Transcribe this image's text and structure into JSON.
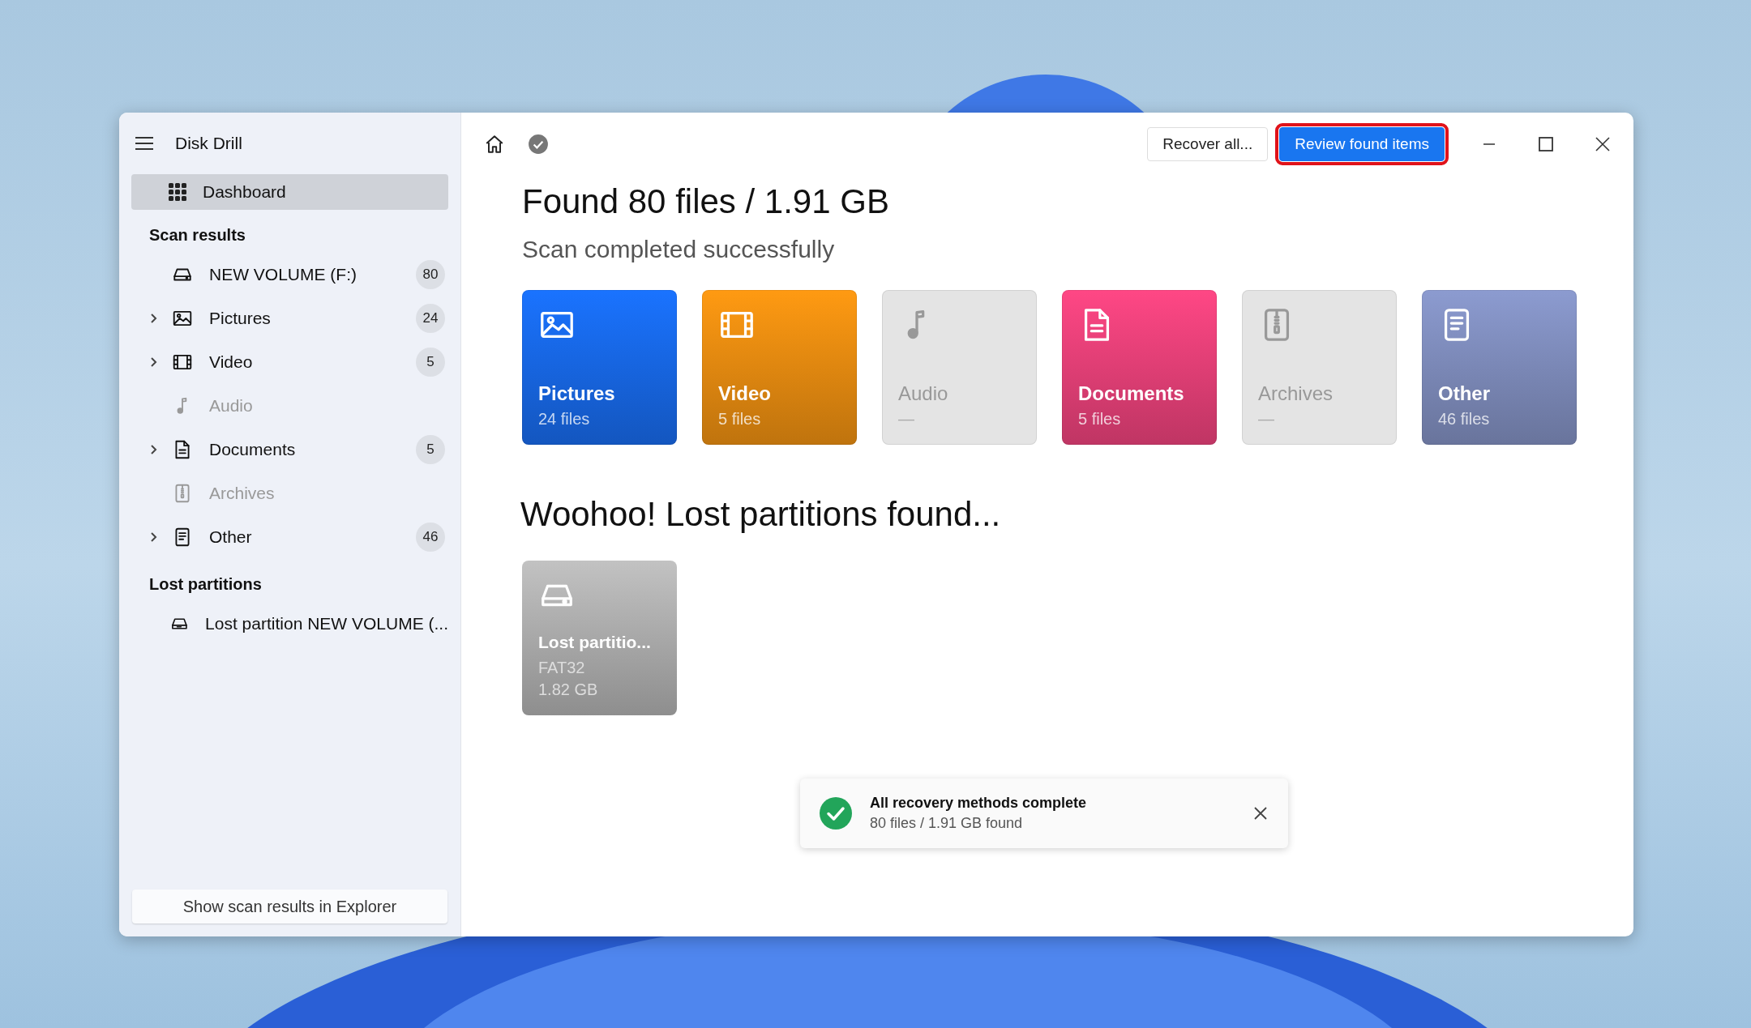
{
  "window": {
    "title": "Disk Drill"
  },
  "sidebar": {
    "dashboard": {
      "label": "Dashboard",
      "selected": true
    },
    "scan_results": {
      "heading": "Scan results",
      "items": [
        {
          "kind": "drive",
          "label": "NEW VOLUME (F:)",
          "count": "80",
          "expandable": false,
          "disabled": false
        },
        {
          "kind": "pictures",
          "label": "Pictures",
          "count": "24",
          "expandable": true,
          "disabled": false
        },
        {
          "kind": "video",
          "label": "Video",
          "count": "5",
          "expandable": true,
          "disabled": false
        },
        {
          "kind": "audio",
          "label": "Audio",
          "expandable": false,
          "disabled": true
        },
        {
          "kind": "documents",
          "label": "Documents",
          "count": "5",
          "expandable": true,
          "disabled": false
        },
        {
          "kind": "archives",
          "label": "Archives",
          "expandable": false,
          "disabled": true
        },
        {
          "kind": "other",
          "label": "Other",
          "count": "46",
          "expandable": true,
          "disabled": false
        }
      ]
    },
    "lost_partitions": {
      "heading": "Lost partitions",
      "items": [
        {
          "kind": "partition",
          "label": "Lost partition NEW VOLUME (...",
          "expandable": false,
          "disabled": false
        }
      ]
    },
    "footer_button": "Show scan results in Explorer"
  },
  "toolbar": {
    "recover_button": "Recover all...",
    "review_button": {
      "label": "Review found items",
      "highlighted": true
    }
  },
  "summary": {
    "title": "Found 80 files / 1.91 GB",
    "subtitle": "Scan completed successfully"
  },
  "categories": [
    {
      "kind": "pictures",
      "label": "Pictures",
      "detail": "24 files",
      "disabled": false,
      "color": "#1a73ff"
    },
    {
      "kind": "video",
      "label": "Video",
      "detail": "5 files",
      "disabled": false,
      "color": "#ff9a12"
    },
    {
      "kind": "audio",
      "label": "Audio",
      "detail": "—",
      "disabled": true,
      "color": "#e4e4e4"
    },
    {
      "kind": "documents",
      "label": "Documents",
      "detail": "5 files",
      "disabled": false,
      "color": "#ff4785"
    },
    {
      "kind": "archives",
      "label": "Archives",
      "detail": "—",
      "disabled": true,
      "color": "#e4e4e4"
    },
    {
      "kind": "other",
      "label": "Other",
      "detail": "46 files",
      "disabled": false,
      "color": "#8c9bd0"
    }
  ],
  "partitions": {
    "heading": "Woohoo! Lost partitions found...",
    "items": [
      {
        "label": "Lost partitio...",
        "filesystem": "FAT32",
        "size": "1.82 GB"
      }
    ]
  },
  "toast": {
    "title": "All recovery methods complete",
    "message": "80 files / 1.91 GB found"
  }
}
